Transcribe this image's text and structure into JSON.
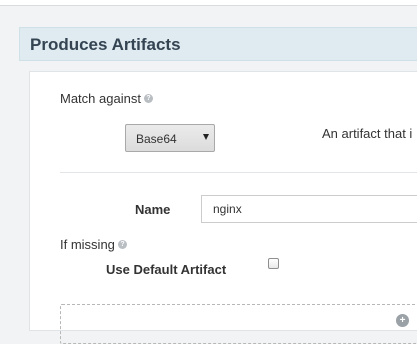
{
  "section": {
    "title": "Produces Artifacts"
  },
  "match_against": {
    "label": "Match against",
    "help_icon": "?",
    "select_value": "Base64",
    "description": "An artifact that i"
  },
  "name_field": {
    "label": "Name",
    "value": "nginx"
  },
  "if_missing": {
    "label": "If missing",
    "help_icon": "?",
    "use_default_label": "Use Default Artifact",
    "use_default_checked": false
  },
  "add_area": {
    "icon": "add-circle-icon"
  },
  "colors": {
    "section_header_bg": "#dfebf0",
    "section_title": "#344452",
    "page_bg": "#f2f3f4",
    "card_bg": "#ffffff"
  }
}
